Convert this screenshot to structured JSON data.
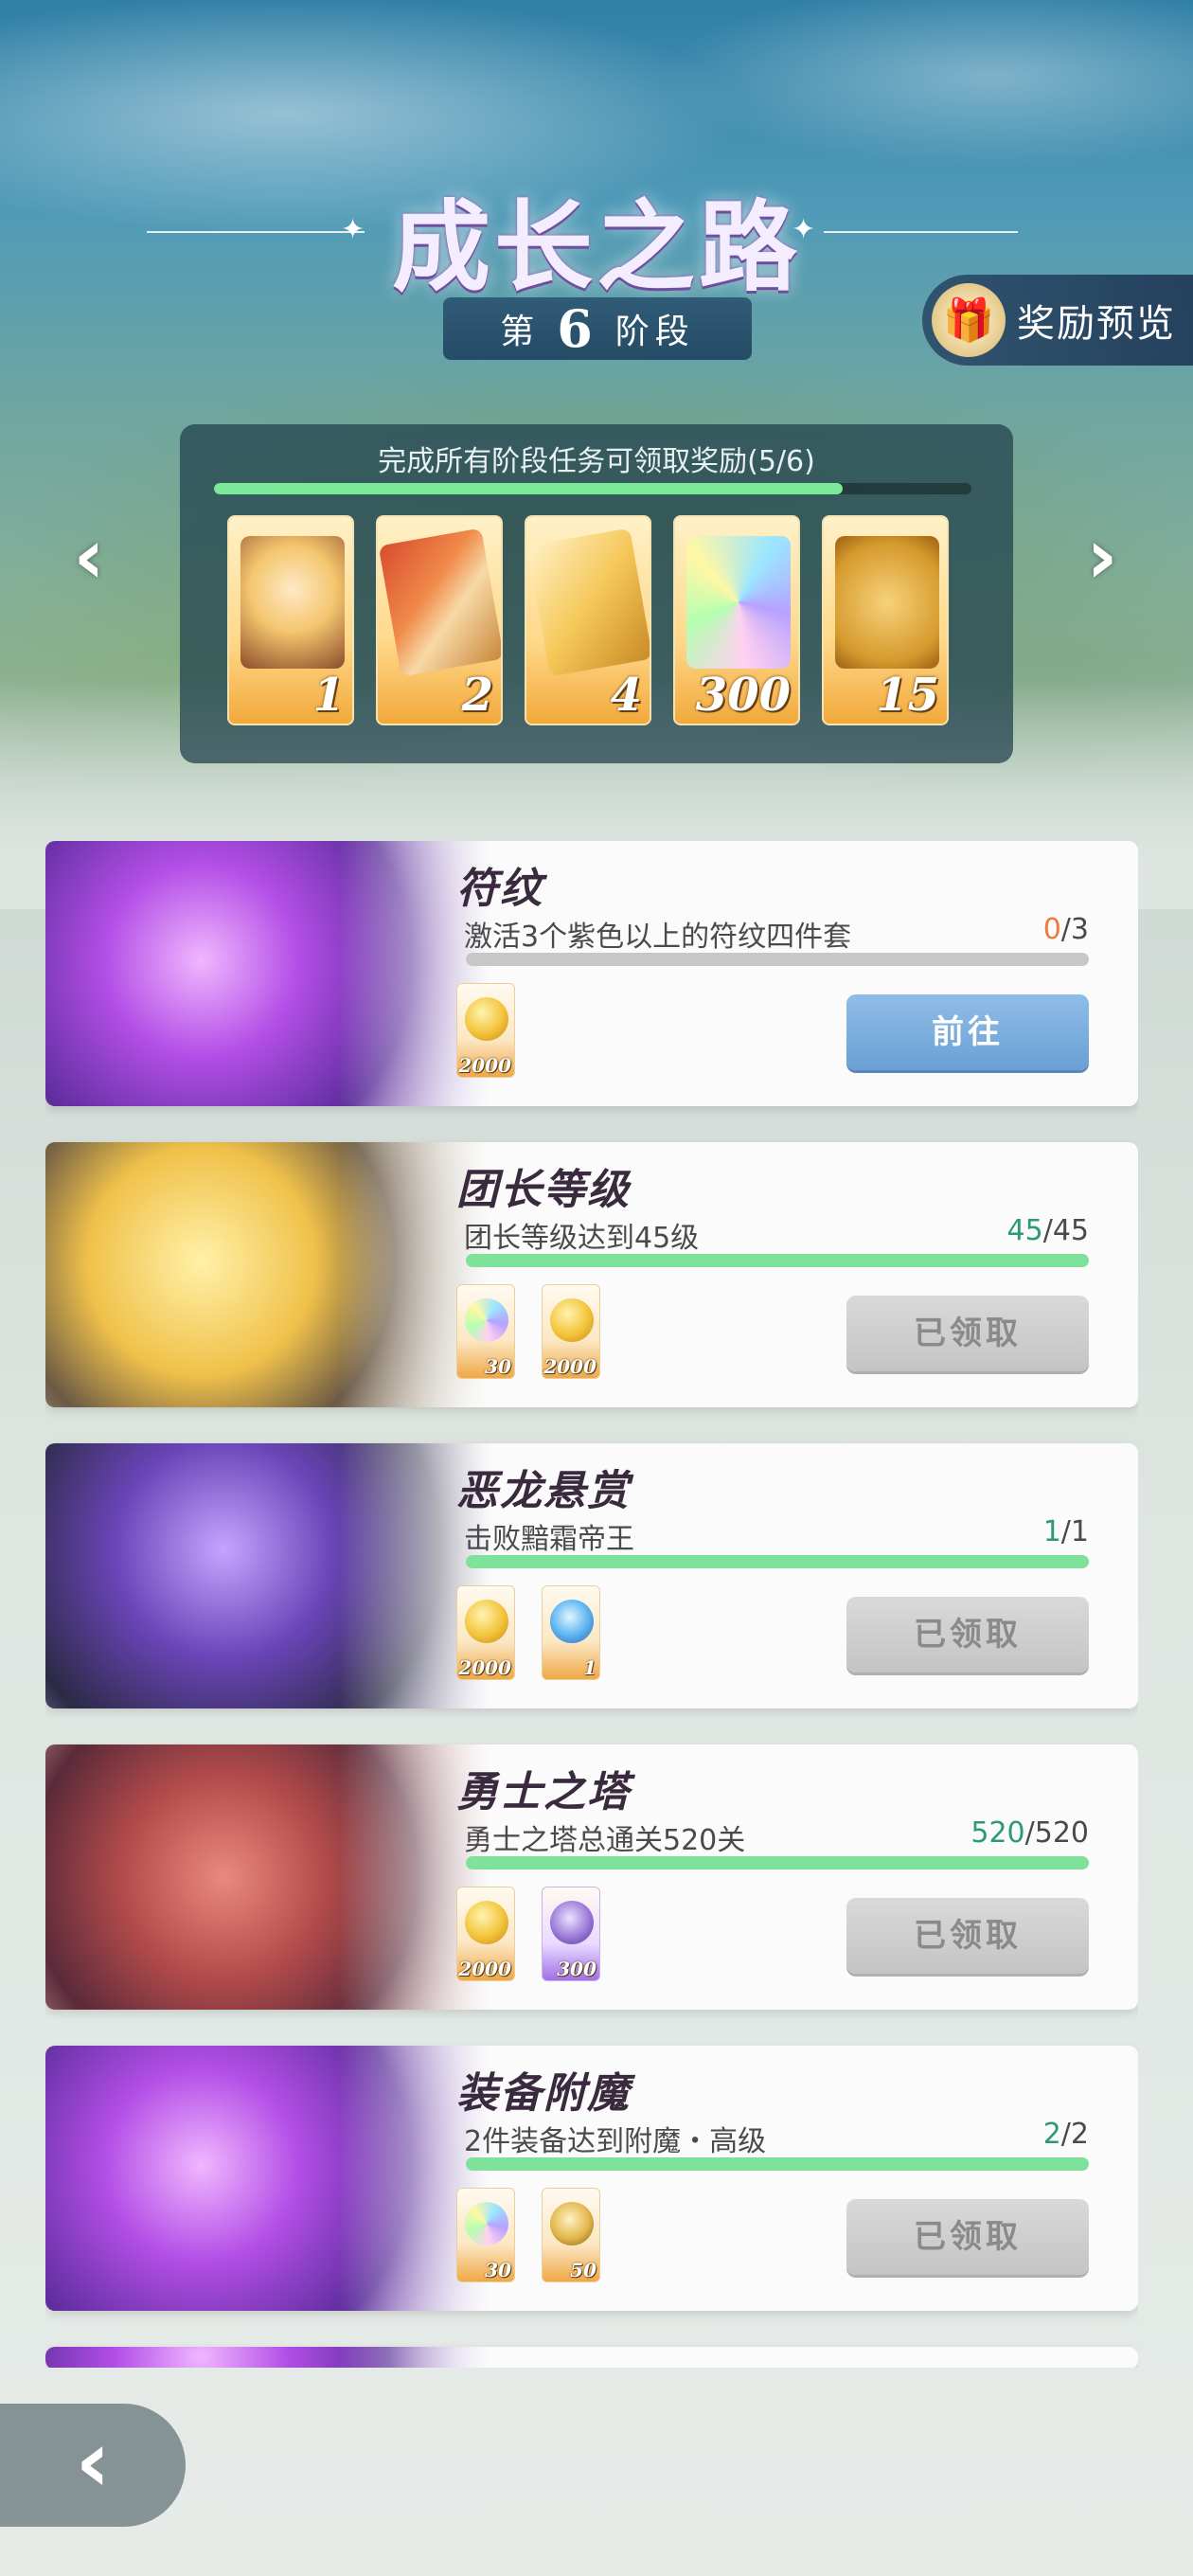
{
  "header": {
    "title": "成长之路",
    "stage_prefix": "第",
    "stage_number": "6",
    "stage_suffix": "阶段",
    "reward_preview_label": "奖励预览"
  },
  "stage_rewards": {
    "text": "完成所有阶段任务可领取奖励(5/6)",
    "progress": 0.83,
    "items": [
      {
        "icon": "character-card-icon",
        "count": "1"
      },
      {
        "icon": "red-scroll-icon",
        "count": "2"
      },
      {
        "icon": "gold-scroll-icon",
        "count": "4"
      },
      {
        "icon": "rainbow-crystal-icon",
        "count": "300"
      },
      {
        "icon": "puzzle-piece-icon",
        "count": "15"
      }
    ]
  },
  "tasks": [
    {
      "title": "符纹",
      "desc": "激活3个紫色以上的符纹四件套",
      "current": "0",
      "total": "/3",
      "progress": 0.0,
      "rewards": [
        {
          "icon": "paw-coin-icon",
          "count": "2000"
        }
      ],
      "button": "前往"
    },
    {
      "title": "团长等级",
      "desc": "团长等级达到45级",
      "current": "45",
      "total": "/45",
      "progress": 1.0,
      "rewards": [
        {
          "icon": "rainbow-crystal-icon",
          "count": "30"
        },
        {
          "icon": "paw-coin-icon",
          "count": "2000"
        }
      ],
      "button": "已领取"
    },
    {
      "title": "恶龙悬赏",
      "desc": "击败黯霜帝王",
      "current": "1",
      "total": "/1",
      "progress": 1.0,
      "rewards": [
        {
          "icon": "paw-coin-icon",
          "count": "2000"
        },
        {
          "icon": "blue-flame-icon",
          "count": "1"
        }
      ],
      "button": "已领取"
    },
    {
      "title": "勇士之塔",
      "desc": "勇士之塔总通关520关",
      "current": "520",
      "total": "/520",
      "progress": 1.0,
      "rewards": [
        {
          "icon": "paw-coin-icon",
          "count": "2000"
        },
        {
          "icon": "purple-feather-icon",
          "count": "300"
        }
      ],
      "button": "已领取"
    },
    {
      "title": "装备附魔",
      "desc": "2件装备达到附魔・高级",
      "current": "2",
      "total": "/2",
      "progress": 1.0,
      "rewards": [
        {
          "icon": "rainbow-crystal-icon",
          "count": "30"
        },
        {
          "icon": "sword-medal-icon",
          "count": "50"
        }
      ],
      "button": "已领取"
    }
  ],
  "colors": {
    "progress_green": "#7fe29a",
    "count_green": "#2b9a7b",
    "count_orange": "#f07a3a",
    "go_button": "#6aa0d6",
    "claimed_button": "#c4c4c4"
  },
  "icons": {
    "left_arrow": "chevron-left-icon",
    "right_arrow": "chevron-right-icon",
    "back": "back-arrow-icon",
    "gift": "gift-icon"
  }
}
